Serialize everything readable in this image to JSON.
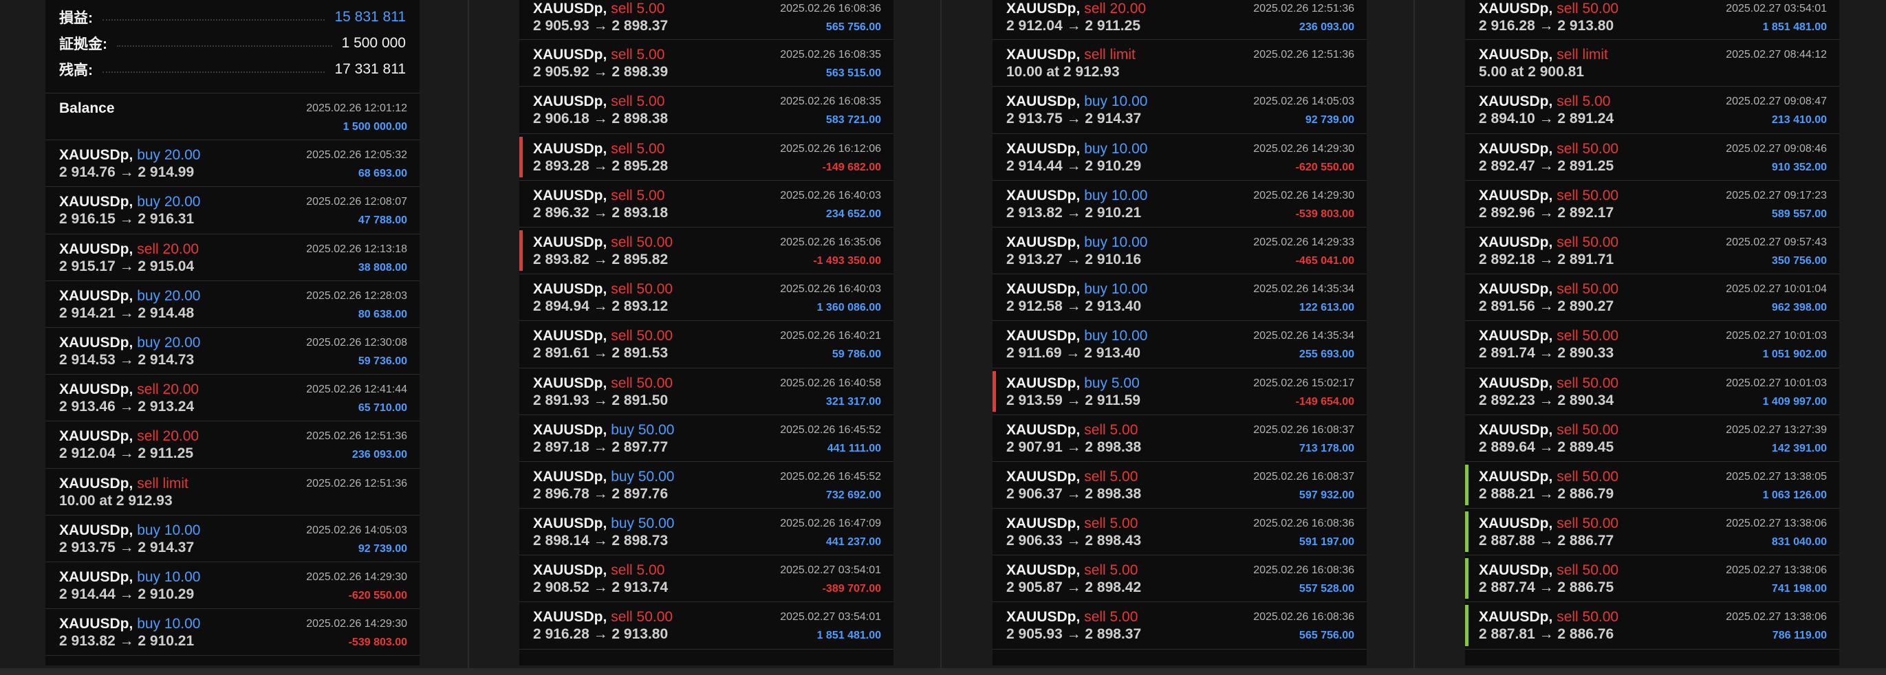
{
  "summary": {
    "profit_label": "損益:",
    "profit_value": "15 831 811",
    "margin_label": "証拠金:",
    "margin_value": "1 500 000",
    "balance_label": "残高:",
    "balance_value": "17 331 811"
  },
  "columns": [
    {
      "rows": [
        {
          "symbol": "Balance",
          "action": "",
          "side": "neutral",
          "detail": "",
          "time": "2025.02.26 12:01:12",
          "profit": "1 500 000.00",
          "pnl": "pos",
          "mark": ""
        },
        {
          "symbol": "XAUUSDp,",
          "action": "buy 20.00",
          "side": "buy",
          "detail": "2 914.76 → 2 914.99",
          "time": "2025.02.26 12:05:32",
          "profit": "68 693.00",
          "pnl": "pos",
          "mark": ""
        },
        {
          "symbol": "XAUUSDp,",
          "action": "buy 20.00",
          "side": "buy",
          "detail": "2 916.15 → 2 916.31",
          "time": "2025.02.26 12:08:07",
          "profit": "47 788.00",
          "pnl": "pos",
          "mark": ""
        },
        {
          "symbol": "XAUUSDp,",
          "action": "sell 20.00",
          "side": "sell",
          "detail": "2 915.17 → 2 915.04",
          "time": "2025.02.26 12:13:18",
          "profit": "38 808.00",
          "pnl": "pos",
          "mark": ""
        },
        {
          "symbol": "XAUUSDp,",
          "action": "buy 20.00",
          "side": "buy",
          "detail": "2 914.21 → 2 914.48",
          "time": "2025.02.26 12:28:03",
          "profit": "80 638.00",
          "pnl": "pos",
          "mark": ""
        },
        {
          "symbol": "XAUUSDp,",
          "action": "buy 20.00",
          "side": "buy",
          "detail": "2 914.53 → 2 914.73",
          "time": "2025.02.26 12:30:08",
          "profit": "59 736.00",
          "pnl": "pos",
          "mark": ""
        },
        {
          "symbol": "XAUUSDp,",
          "action": "sell 20.00",
          "side": "sell",
          "detail": "2 913.46 → 2 913.24",
          "time": "2025.02.26 12:41:44",
          "profit": "65 710.00",
          "pnl": "pos",
          "mark": ""
        },
        {
          "symbol": "XAUUSDp,",
          "action": "sell 20.00",
          "side": "sell",
          "detail": "2 912.04 → 2 911.25",
          "time": "2025.02.26 12:51:36",
          "profit": "236 093.00",
          "pnl": "pos",
          "mark": ""
        },
        {
          "symbol": "XAUUSDp,",
          "action": "sell limit",
          "side": "sell",
          "detail": "10.00 at 2 912.93",
          "time": "2025.02.26 12:51:36",
          "profit": "",
          "pnl": "pos",
          "mark": ""
        },
        {
          "symbol": "XAUUSDp,",
          "action": "buy 10.00",
          "side": "buy",
          "detail": "2 913.75 → 2 914.37",
          "time": "2025.02.26 14:05:03",
          "profit": "92 739.00",
          "pnl": "pos",
          "mark": ""
        },
        {
          "symbol": "XAUUSDp,",
          "action": "buy 10.00",
          "side": "buy",
          "detail": "2 914.44 → 2 910.29",
          "time": "2025.02.26 14:29:30",
          "profit": "-620 550.00",
          "pnl": "neg",
          "mark": ""
        },
        {
          "symbol": "XAUUSDp,",
          "action": "buy 10.00",
          "side": "buy",
          "detail": "2 913.82 → 2 910.21",
          "time": "2025.02.26 14:29:30",
          "profit": "-539 803.00",
          "pnl": "neg",
          "mark": ""
        }
      ]
    },
    {
      "rows": [
        {
          "symbol": "XAUUSDp,",
          "action": "sell 5.00",
          "side": "sell",
          "detail": "2 905.93 → 2 898.37",
          "time": "2025.02.26 16:08:36",
          "profit": "565 756.00",
          "pnl": "pos",
          "mark": ""
        },
        {
          "symbol": "XAUUSDp,",
          "action": "sell 5.00",
          "side": "sell",
          "detail": "2 905.92 → 2 898.39",
          "time": "2025.02.26 16:08:35",
          "profit": "563 515.00",
          "pnl": "pos",
          "mark": ""
        },
        {
          "symbol": "XAUUSDp,",
          "action": "sell 5.00",
          "side": "sell",
          "detail": "2 906.18 → 2 898.38",
          "time": "2025.02.26 16:08:35",
          "profit": "583 721.00",
          "pnl": "pos",
          "mark": ""
        },
        {
          "symbol": "XAUUSDp,",
          "action": "sell 5.00",
          "side": "sell",
          "detail": "2 893.28 → 2 895.28",
          "time": "2025.02.26 16:12:06",
          "profit": "-149 682.00",
          "pnl": "neg",
          "mark": "red"
        },
        {
          "symbol": "XAUUSDp,",
          "action": "sell 5.00",
          "side": "sell",
          "detail": "2 896.32 → 2 893.18",
          "time": "2025.02.26 16:40:03",
          "profit": "234 652.00",
          "pnl": "pos",
          "mark": ""
        },
        {
          "symbol": "XAUUSDp,",
          "action": "sell 50.00",
          "side": "sell",
          "detail": "2 893.82 → 2 895.82",
          "time": "2025.02.26 16:35:06",
          "profit": "-1 493 350.00",
          "pnl": "neg",
          "mark": "red"
        },
        {
          "symbol": "XAUUSDp,",
          "action": "sell 50.00",
          "side": "sell",
          "detail": "2 894.94 → 2 893.12",
          "time": "2025.02.26 16:40:03",
          "profit": "1 360 086.00",
          "pnl": "pos",
          "mark": ""
        },
        {
          "symbol": "XAUUSDp,",
          "action": "sell 50.00",
          "side": "sell",
          "detail": "2 891.61 → 2 891.53",
          "time": "2025.02.26 16:40:21",
          "profit": "59 786.00",
          "pnl": "pos",
          "mark": ""
        },
        {
          "symbol": "XAUUSDp,",
          "action": "sell 50.00",
          "side": "sell",
          "detail": "2 891.93 → 2 891.50",
          "time": "2025.02.26 16:40:58",
          "profit": "321 317.00",
          "pnl": "pos",
          "mark": ""
        },
        {
          "symbol": "XAUUSDp,",
          "action": "buy 50.00",
          "side": "buy",
          "detail": "2 897.18 → 2 897.77",
          "time": "2025.02.26 16:45:52",
          "profit": "441 111.00",
          "pnl": "pos",
          "mark": ""
        },
        {
          "symbol": "XAUUSDp,",
          "action": "buy 50.00",
          "side": "buy",
          "detail": "2 896.78 → 2 897.76",
          "time": "2025.02.26 16:45:52",
          "profit": "732 692.00",
          "pnl": "pos",
          "mark": ""
        },
        {
          "symbol": "XAUUSDp,",
          "action": "buy 50.00",
          "side": "buy",
          "detail": "2 898.14 → 2 898.73",
          "time": "2025.02.26 16:47:09",
          "profit": "441 237.00",
          "pnl": "pos",
          "mark": ""
        },
        {
          "symbol": "XAUUSDp,",
          "action": "sell 5.00",
          "side": "sell",
          "detail": "2 908.52 → 2 913.74",
          "time": "2025.02.27 03:54:01",
          "profit": "-389 707.00",
          "pnl": "neg",
          "mark": ""
        },
        {
          "symbol": "XAUUSDp,",
          "action": "sell 50.00",
          "side": "sell",
          "detail": "2 916.28 → 2 913.80",
          "time": "2025.02.27 03:54:01",
          "profit": "1 851 481.00",
          "pnl": "pos",
          "mark": ""
        }
      ]
    },
    {
      "rows": [
        {
          "symbol": "XAUUSDp,",
          "action": "sell 20.00",
          "side": "sell",
          "detail": "2 912.04 → 2 911.25",
          "time": "2025.02.26 12:51:36",
          "profit": "236 093.00",
          "pnl": "pos",
          "mark": ""
        },
        {
          "symbol": "XAUUSDp,",
          "action": "sell limit",
          "side": "sell",
          "detail": "10.00 at 2 912.93",
          "time": "2025.02.26 12:51:36",
          "profit": "",
          "pnl": "pos",
          "mark": ""
        },
        {
          "symbol": "XAUUSDp,",
          "action": "buy 10.00",
          "side": "buy",
          "detail": "2 913.75 → 2 914.37",
          "time": "2025.02.26 14:05:03",
          "profit": "92 739.00",
          "pnl": "pos",
          "mark": ""
        },
        {
          "symbol": "XAUUSDp,",
          "action": "buy 10.00",
          "side": "buy",
          "detail": "2 914.44 → 2 910.29",
          "time": "2025.02.26 14:29:30",
          "profit": "-620 550.00",
          "pnl": "neg",
          "mark": ""
        },
        {
          "symbol": "XAUUSDp,",
          "action": "buy 10.00",
          "side": "buy",
          "detail": "2 913.82 → 2 910.21",
          "time": "2025.02.26 14:29:30",
          "profit": "-539 803.00",
          "pnl": "neg",
          "mark": ""
        },
        {
          "symbol": "XAUUSDp,",
          "action": "buy 10.00",
          "side": "buy",
          "detail": "2 913.27 → 2 910.16",
          "time": "2025.02.26 14:29:33",
          "profit": "-465 041.00",
          "pnl": "neg",
          "mark": ""
        },
        {
          "symbol": "XAUUSDp,",
          "action": "buy 10.00",
          "side": "buy",
          "detail": "2 912.58 → 2 913.40",
          "time": "2025.02.26 14:35:34",
          "profit": "122 613.00",
          "pnl": "pos",
          "mark": ""
        },
        {
          "symbol": "XAUUSDp,",
          "action": "buy 10.00",
          "side": "buy",
          "detail": "2 911.69 → 2 913.40",
          "time": "2025.02.26 14:35:34",
          "profit": "255 693.00",
          "pnl": "pos",
          "mark": ""
        },
        {
          "symbol": "XAUUSDp,",
          "action": "buy 5.00",
          "side": "buy",
          "detail": "2 913.59 → 2 911.59",
          "time": "2025.02.26 15:02:17",
          "profit": "-149 654.00",
          "pnl": "neg",
          "mark": "red"
        },
        {
          "symbol": "XAUUSDp,",
          "action": "sell 5.00",
          "side": "sell",
          "detail": "2 907.91 → 2 898.38",
          "time": "2025.02.26 16:08:37",
          "profit": "713 178.00",
          "pnl": "pos",
          "mark": ""
        },
        {
          "symbol": "XAUUSDp,",
          "action": "sell 5.00",
          "side": "sell",
          "detail": "2 906.37 → 2 898.38",
          "time": "2025.02.26 16:08:37",
          "profit": "597 932.00",
          "pnl": "pos",
          "mark": ""
        },
        {
          "symbol": "XAUUSDp,",
          "action": "sell 5.00",
          "side": "sell",
          "detail": "2 906.33 → 2 898.43",
          "time": "2025.02.26 16:08:36",
          "profit": "591 197.00",
          "pnl": "pos",
          "mark": ""
        },
        {
          "symbol": "XAUUSDp,",
          "action": "sell 5.00",
          "side": "sell",
          "detail": "2 905.87 → 2 898.42",
          "time": "2025.02.26 16:08:36",
          "profit": "557 528.00",
          "pnl": "pos",
          "mark": ""
        },
        {
          "symbol": "XAUUSDp,",
          "action": "sell 5.00",
          "side": "sell",
          "detail": "2 905.93 → 2 898.37",
          "time": "2025.02.26 16:08:36",
          "profit": "565 756.00",
          "pnl": "pos",
          "mark": ""
        }
      ]
    },
    {
      "rows": [
        {
          "symbol": "XAUUSDp,",
          "action": "sell 50.00",
          "side": "sell",
          "detail": "2 916.28 → 2 913.80",
          "time": "2025.02.27 03:54:01",
          "profit": "1 851 481.00",
          "pnl": "pos",
          "mark": ""
        },
        {
          "symbol": "XAUUSDp,",
          "action": "sell limit",
          "side": "sell",
          "detail": "5.00 at 2 900.81",
          "time": "2025.02.27 08:44:12",
          "profit": "",
          "pnl": "pos",
          "mark": ""
        },
        {
          "symbol": "XAUUSDp,",
          "action": "sell 5.00",
          "side": "sell",
          "detail": "2 894.10 → 2 891.24",
          "time": "2025.02.27 09:08:47",
          "profit": "213 410.00",
          "pnl": "pos",
          "mark": ""
        },
        {
          "symbol": "XAUUSDp,",
          "action": "sell 50.00",
          "side": "sell",
          "detail": "2 892.47 → 2 891.25",
          "time": "2025.02.27 09:08:46",
          "profit": "910 352.00",
          "pnl": "pos",
          "mark": ""
        },
        {
          "symbol": "XAUUSDp,",
          "action": "sell 50.00",
          "side": "sell",
          "detail": "2 892.96 → 2 892.17",
          "time": "2025.02.27 09:17:23",
          "profit": "589 557.00",
          "pnl": "pos",
          "mark": ""
        },
        {
          "symbol": "XAUUSDp,",
          "action": "sell 50.00",
          "side": "sell",
          "detail": "2 892.18 → 2 891.71",
          "time": "2025.02.27 09:57:43",
          "profit": "350 756.00",
          "pnl": "pos",
          "mark": ""
        },
        {
          "symbol": "XAUUSDp,",
          "action": "sell 50.00",
          "side": "sell",
          "detail": "2 891.56 → 2 890.27",
          "time": "2025.02.27 10:01:04",
          "profit": "962 398.00",
          "pnl": "pos",
          "mark": ""
        },
        {
          "symbol": "XAUUSDp,",
          "action": "sell 50.00",
          "side": "sell",
          "detail": "2 891.74 → 2 890.33",
          "time": "2025.02.27 10:01:03",
          "profit": "1 051 902.00",
          "pnl": "pos",
          "mark": ""
        },
        {
          "symbol": "XAUUSDp,",
          "action": "sell 50.00",
          "side": "sell",
          "detail": "2 892.23 → 2 890.34",
          "time": "2025.02.27 10:01:03",
          "profit": "1 409 997.00",
          "pnl": "pos",
          "mark": ""
        },
        {
          "symbol": "XAUUSDp,",
          "action": "sell 50.00",
          "side": "sell",
          "detail": "2 889.64 → 2 889.45",
          "time": "2025.02.27 13:27:39",
          "profit": "142 391.00",
          "pnl": "pos",
          "mark": ""
        },
        {
          "symbol": "XAUUSDp,",
          "action": "sell 50.00",
          "side": "sell",
          "detail": "2 888.21 → 2 886.79",
          "time": "2025.02.27 13:38:05",
          "profit": "1 063 126.00",
          "pnl": "pos",
          "mark": "green"
        },
        {
          "symbol": "XAUUSDp,",
          "action": "sell 50.00",
          "side": "sell",
          "detail": "2 887.88 → 2 886.77",
          "time": "2025.02.27 13:38:06",
          "profit": "831 040.00",
          "pnl": "pos",
          "mark": "green"
        },
        {
          "symbol": "XAUUSDp,",
          "action": "sell 50.00",
          "side": "sell",
          "detail": "2 887.74 → 2 886.75",
          "time": "2025.02.27 13:38:06",
          "profit": "741 198.00",
          "pnl": "pos",
          "mark": "green"
        },
        {
          "symbol": "XAUUSDp,",
          "action": "sell 50.00",
          "side": "sell",
          "detail": "2 887.81 → 2 886.76",
          "time": "2025.02.27 13:38:06",
          "profit": "786 119.00",
          "pnl": "pos",
          "mark": "green"
        }
      ]
    }
  ]
}
